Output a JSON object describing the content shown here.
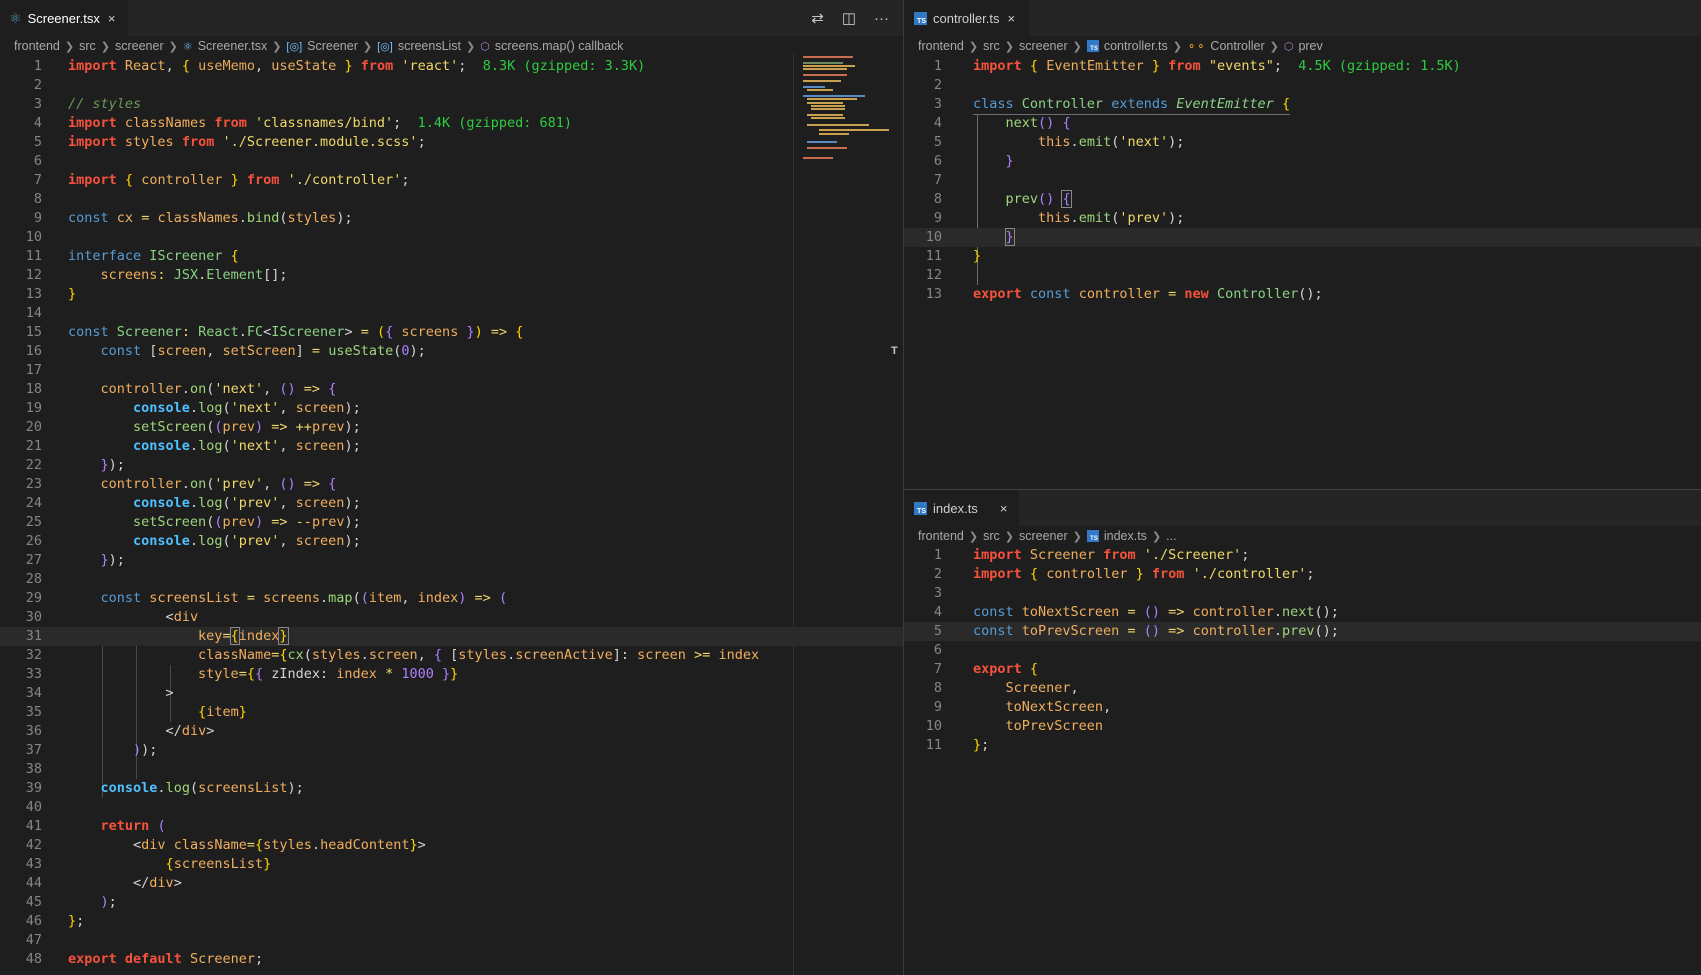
{
  "left_editor": {
    "tab": {
      "label": "Screener.tsx",
      "close": "×",
      "icon": "react-icon"
    },
    "actions": {
      "compare": "⇄",
      "split": "◫",
      "more": "···"
    },
    "breadcrumbs": [
      "frontend",
      "src",
      "screener",
      "Screener.tsx",
      "Screener",
      "screensList",
      "screens.map() callback"
    ],
    "line_numbers": [
      "1",
      "2",
      "3",
      "4",
      "5",
      "6",
      "7",
      "8",
      "9",
      "10",
      "11",
      "12",
      "13",
      "14",
      "15",
      "16",
      "17",
      "18",
      "19",
      "20",
      "21",
      "22",
      "23",
      "24",
      "25",
      "26",
      "27",
      "28",
      "29",
      "30",
      "31",
      "32",
      "33",
      "34",
      "35",
      "36",
      "37",
      "38",
      "39",
      "40",
      "41",
      "42",
      "43",
      "44",
      "45",
      "46",
      "47",
      "48"
    ],
    "import_size_hints": [
      "8.3K (gzipped: 3.3K)",
      "1.4K (gzipped: 681)"
    ]
  },
  "right_top_editor": {
    "tab": {
      "label": "controller.ts",
      "close": "×",
      "icon": "typescript-icon"
    },
    "breadcrumbs": [
      "frontend",
      "src",
      "screener",
      "controller.ts",
      "Controller",
      "prev"
    ],
    "line_numbers": [
      "1",
      "2",
      "3",
      "4",
      "5",
      "6",
      "7",
      "8",
      "9",
      "10",
      "11",
      "12",
      "13"
    ],
    "import_size_hint": "4.5K (gzipped: 1.5K)"
  },
  "right_bottom_editor": {
    "tab": {
      "label": "index.ts",
      "close": "×",
      "icon": "typescript-icon"
    },
    "breadcrumbs": [
      "frontend",
      "src",
      "screener",
      "index.ts",
      "..."
    ],
    "line_numbers": [
      "1",
      "2",
      "3",
      "4",
      "5",
      "6",
      "7",
      "8",
      "9",
      "10",
      "11"
    ]
  },
  "colors": {
    "editor_bg": "#1e1e1e",
    "tab_bar_bg": "#252526",
    "keyword": "#f5523c",
    "string": "#f0d86a",
    "size_hint": "#2ecc40"
  }
}
